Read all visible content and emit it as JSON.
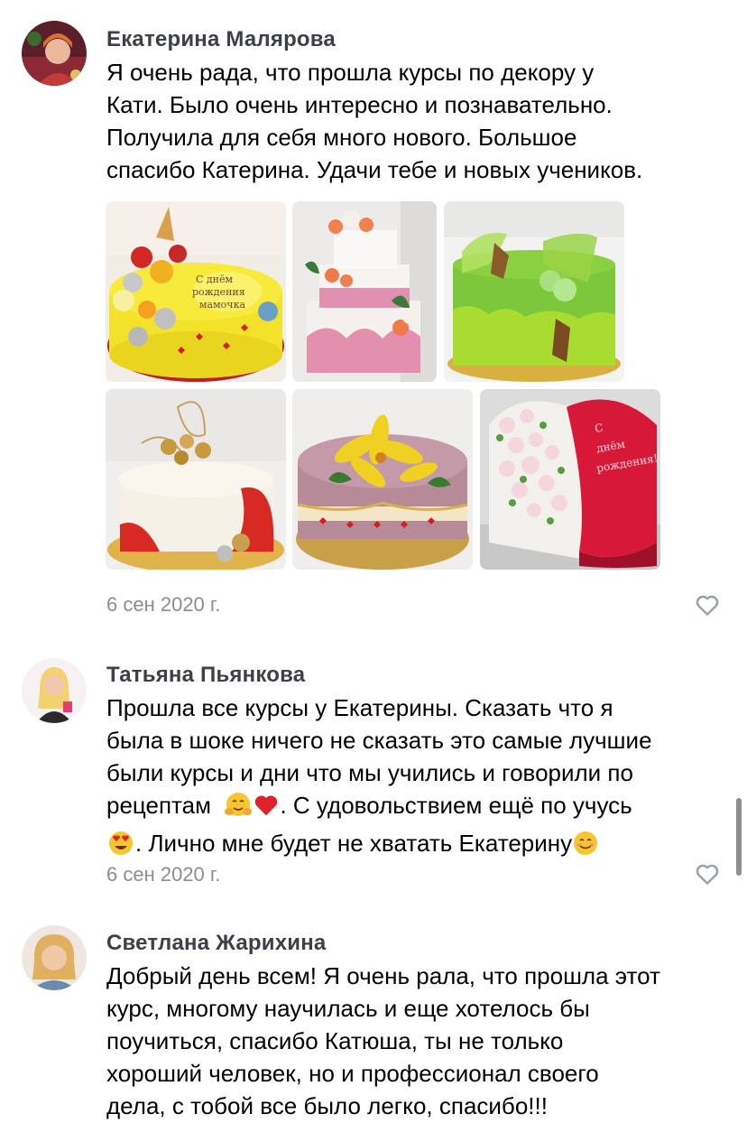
{
  "comments": [
    {
      "author": "Екатерина Малярова",
      "text": "Я очень рада, что прошла курсы по декору у\nКати.  Было очень интересно и познавательно.\nПолучила для себя много нового. Большое\nспасибо Катерина. Удачи тебе и новых учеников.",
      "date": "6 сен 2020 г.",
      "photos": [
        {
          "icon": "yellow-cake-photo",
          "inscription": "С днём рождения мамочка"
        },
        {
          "icon": "three-tier-cake-photo"
        },
        {
          "icon": "green-cake-photo"
        },
        {
          "icon": "white-red-cake-photo"
        },
        {
          "icon": "flower-cake-photo"
        },
        {
          "icon": "heart-cake-photo",
          "inscription": "С днём рождения!"
        }
      ]
    },
    {
      "author": "Татьяна Пьянкова",
      "text_line1": "Прошла все курсы у Екатерины. Сказать что я",
      "text_line2": "была в шоке ничего не сказать  это самые лучшие",
      "text_line3": "были курсы и дни что мы учились и говорили по",
      "text_line4a": "рецептам  ",
      "text_line4b": ". С удовольствием ещё по  учусь",
      "text_line5a": ".  Лично мне будет не хватать Екатерину",
      "emojis": [
        "hugging-face-emoji",
        "red-heart-emoji",
        "heart-eyes-emoji",
        "smiling-face-emoji"
      ],
      "date": "6 сен 2020 г."
    },
    {
      "author": "Светлана Жарихина",
      "text": "Добрый день всем! Я очень рала, что прошла этот\nкурс, многому научилась и еще хотелось бы\nпоучиться, спасибо Катюша, ты не только\nхороший человек, но и профессионал своего\nдела, с тобой все было легко, спасибо!!!"
    }
  ],
  "colors": {
    "author": "#3d4047",
    "date": "#8a8d93",
    "like_icon": "#99a2ad"
  }
}
